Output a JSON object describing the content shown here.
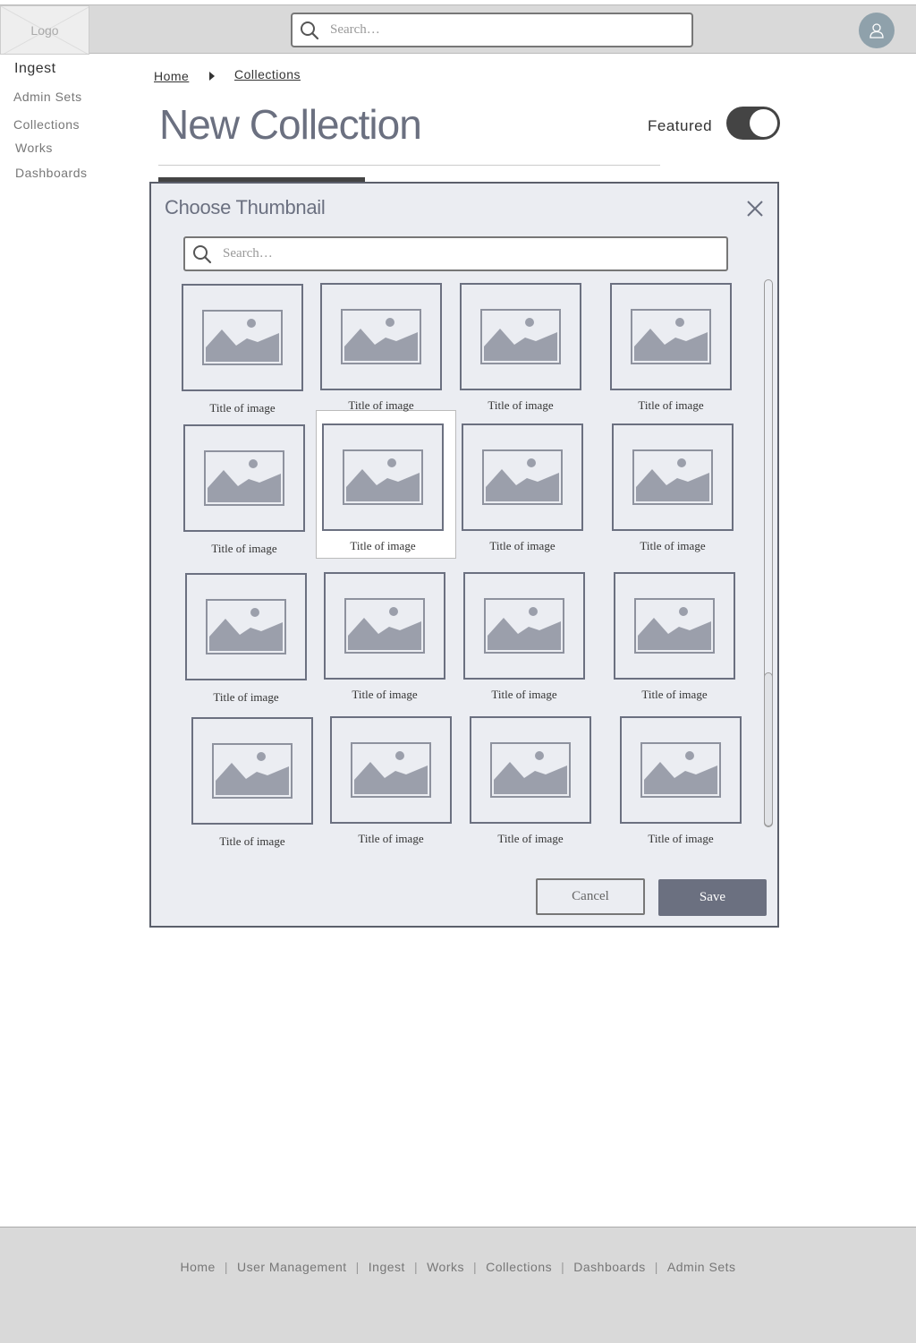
{
  "header": {
    "logo_text": "Logo",
    "search_placeholder": "Search…"
  },
  "sidebar": {
    "title": "Ingest",
    "items": [
      "Admin Sets",
      "Collections",
      "Works",
      "Dashboards"
    ]
  },
  "breadcrumb": [
    "Home",
    "Collections"
  ],
  "page": {
    "title": "New Collection",
    "featured_label": "Featured",
    "featured_on": true
  },
  "modal": {
    "title": "Choose Thumbnail",
    "search_placeholder": "Search…",
    "thumbnails": [
      {
        "caption": "Title of image"
      },
      {
        "caption": "Title of image"
      },
      {
        "caption": "Title of image"
      },
      {
        "caption": "Title of image"
      },
      {
        "caption": "Title of image"
      },
      {
        "caption": "Title of image"
      },
      {
        "caption": "Title of image"
      },
      {
        "caption": "Title of image"
      },
      {
        "caption": "Title of image"
      },
      {
        "caption": "Title of image"
      },
      {
        "caption": "Title of image"
      },
      {
        "caption": "Title of image"
      },
      {
        "caption": "Title of image"
      },
      {
        "caption": "Title of image"
      },
      {
        "caption": "Title of image"
      },
      {
        "caption": "Title of image"
      }
    ],
    "cancel_label": "Cancel",
    "save_label": "Save"
  },
  "footer": {
    "links": [
      "Home",
      "User Management",
      "Ingest",
      "Works",
      "Collections",
      "Dashboards",
      "Admin Sets"
    ],
    "separator": "|"
  },
  "colors": {
    "accent": "#6b7080",
    "header_bg": "#d9d9d9",
    "modal_bg": "#ebedf2",
    "avatar": "#8fa1ab"
  }
}
